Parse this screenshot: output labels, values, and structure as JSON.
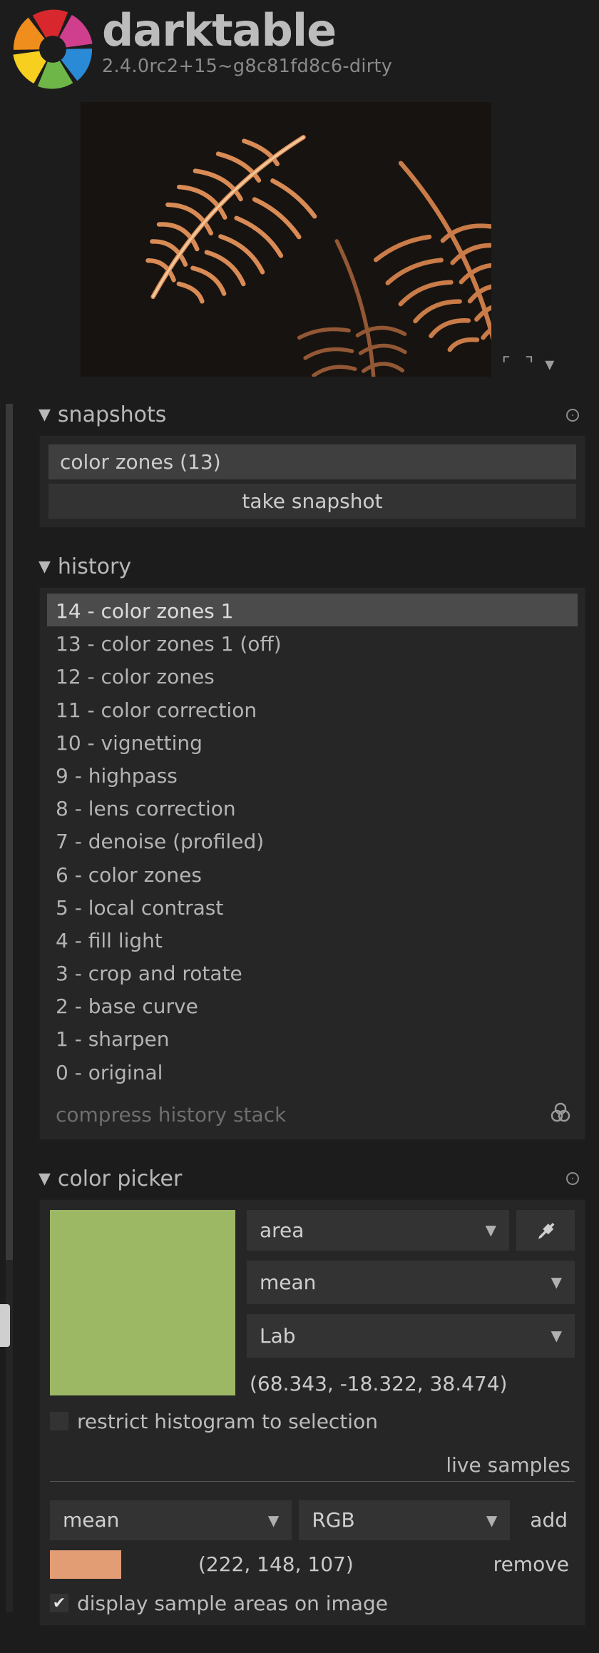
{
  "header": {
    "title": "darktable",
    "version": "2.4.0rc2+15~g8c81fd8c6-dirty"
  },
  "logo_colors": {
    "red": "#d8272d",
    "orange": "#ef8e1c",
    "yellow": "#f6cf1f",
    "green": "#6fb648",
    "blue": "#2a8ad6",
    "magenta": "#cf3f8e"
  },
  "preview": {
    "controls": {
      "fullscreen": "⛶",
      "collapse": "▾"
    }
  },
  "panels": {
    "snapshots": {
      "title": "snapshots",
      "items": [
        {
          "label": "color zones (13)"
        }
      ],
      "take_label": "take snapshot"
    },
    "history": {
      "title": "history",
      "selected_index": 0,
      "items": [
        {
          "label": "14 - color zones 1"
        },
        {
          "label": "13 - color zones 1 (off)"
        },
        {
          "label": "12 - color zones"
        },
        {
          "label": "11 - color correction"
        },
        {
          "label": "10 - vignetting"
        },
        {
          "label": "9 - highpass"
        },
        {
          "label": "8 - lens correction"
        },
        {
          "label": "7 - denoise (profiled)"
        },
        {
          "label": "6 - color zones"
        },
        {
          "label": "5 - local contrast"
        },
        {
          "label": "4 - fill light"
        },
        {
          "label": "3 - crop and rotate"
        },
        {
          "label": "2 - base curve"
        },
        {
          "label": "1 - sharpen"
        },
        {
          "label": "0 - original"
        }
      ],
      "compress_label": "compress history stack"
    },
    "color_picker": {
      "title": "color picker",
      "swatch_color": "#9cb865",
      "mode": "area",
      "stat": "mean",
      "space": "Lab",
      "value": "(68.343, -18.322, 38.474)",
      "restrict_label": "restrict histogram to selection",
      "restrict_checked": false,
      "live_samples_label": "live samples",
      "live": {
        "stat": "mean",
        "space": "RGB",
        "add_label": "add",
        "remove_label": "remove",
        "swatch_color": "#e39d75",
        "value": "(222, 148, 107)"
      },
      "display_areas_label": "display sample areas on image",
      "display_areas_checked": true,
      "checkmark": "✔"
    }
  }
}
